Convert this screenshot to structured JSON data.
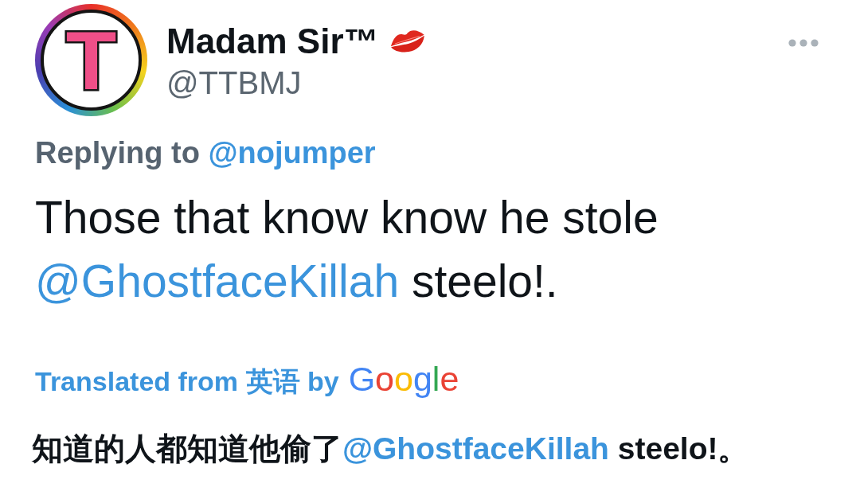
{
  "author": {
    "avatar_letter": "T",
    "display_name": "Madam Sir™",
    "handle": "@TTBMJ"
  },
  "reply_context": {
    "label": "Replying to",
    "mention": "@nojumper"
  },
  "tweet_text": [
    {
      "kind": "text",
      "text": "Those that know know he stole "
    },
    {
      "kind": "mention",
      "text": "@GhostfaceKillah"
    },
    {
      "kind": "text",
      "text": " steelo!."
    }
  ],
  "translation": {
    "label": "Translated from 英语 by",
    "provider": "Google",
    "text": [
      {
        "kind": "text",
        "text": "知道的人都知道他偷了"
      },
      {
        "kind": "mention",
        "text": "@GhostfaceKillah"
      },
      {
        "kind": "text",
        "text": " steelo!。"
      }
    ]
  }
}
